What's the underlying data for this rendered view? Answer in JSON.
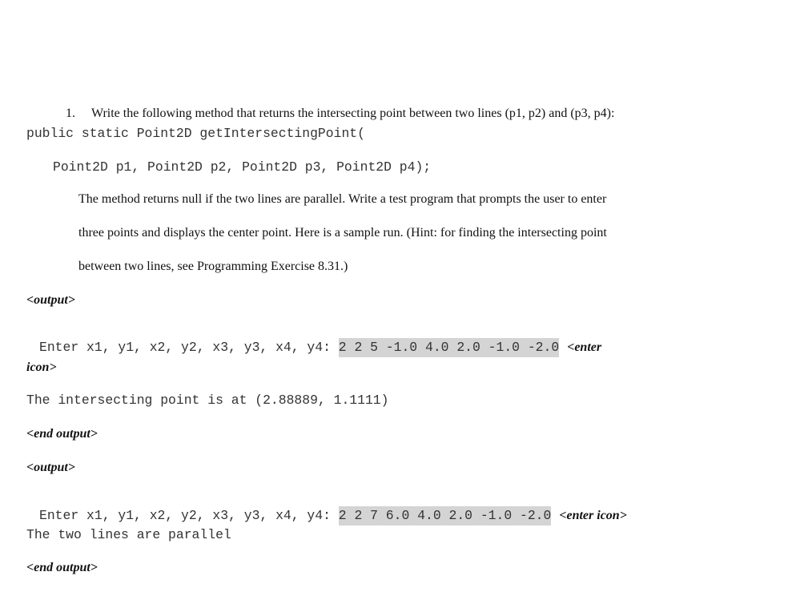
{
  "exercise": {
    "number": "1.",
    "intro": "Write the following method that returns the intersecting point between two lines (p1, p2) and (p3, p4):",
    "signature_line1": "public static Point2D getIntersectingPoint(",
    "signature_line2": "Point2D p1, Point2D p2, Point2D p3, Point2D p4);",
    "description_lines": [
      "The method returns null if the two lines are parallel. Write a test program that prompts the user to enter",
      "three points and displays the center point. Here is a sample run. (Hint: for finding the intersecting point",
      "between two lines, see Programming Exercise 8.31.)"
    ]
  },
  "sample_runs": [
    {
      "open_tag": "<output>",
      "prompt": "Enter x1, y1, x2, y2, x3, y3, x4, y4: ",
      "user_input": "2 2 5 -1.0 4.0 2.0 -1.0 -2.0",
      "enter_tag_part1": "<enter",
      "enter_tag_part2": "icon>",
      "result": "The intersecting point is at (2.88889, 1.1111)",
      "close_tag": "<end output>"
    },
    {
      "open_tag": "<output>",
      "prompt": "Enter x1, y1, x2, y2, x3, y3, x4, y4: ",
      "user_input": "2 2 7 6.0 4.0 2.0 -1.0 -2.0",
      "enter_tag": "<enter icon>",
      "result": "The two lines are parallel",
      "close_tag": "<end output>"
    }
  ],
  "colors": {
    "input_highlight": "#d4d4d4"
  }
}
